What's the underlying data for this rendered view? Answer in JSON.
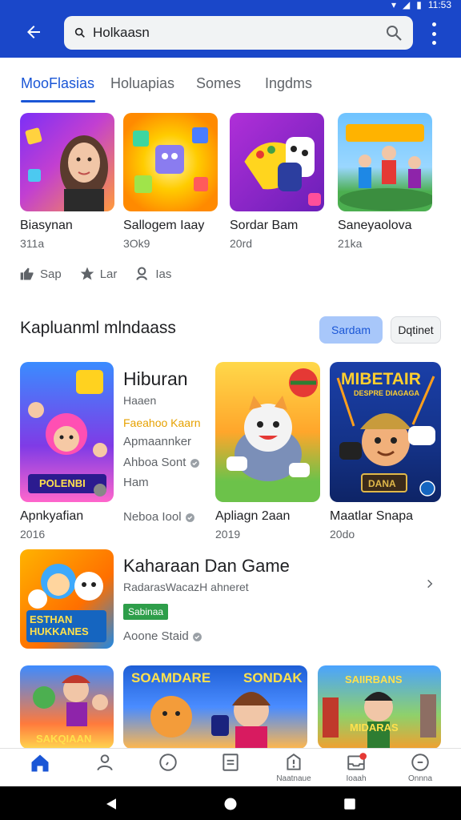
{
  "header": {
    "search_query": "Holkaasn",
    "back_icon": "arrow-back-icon",
    "search_icon": "search-icon",
    "menu_icon": "more-vert-icon",
    "brand_color": "#1a47c9"
  },
  "tabs": [
    {
      "label": "MooFlasias",
      "active": true
    },
    {
      "label": "Holuapias"
    },
    {
      "label": "Somes"
    },
    {
      "label": "Ingdms"
    }
  ],
  "featured": [
    {
      "title": "Biasynan",
      "sub": "311a"
    },
    {
      "title": "Sallogem Iaay",
      "sub": "3Ok9"
    },
    {
      "title": "Sordar Bam",
      "sub": "20rd"
    },
    {
      "title": "Saneyaolova",
      "sub": "21ka"
    }
  ],
  "meta": [
    {
      "icon": "thumb-up-icon",
      "label": "Sap"
    },
    {
      "icon": "star-icon",
      "label": "Lar"
    },
    {
      "icon": "person-icon",
      "label": "Ias"
    }
  ],
  "section": {
    "title": "Kapluanml mlndaass",
    "primary_button": "Sardam",
    "secondary_button": "Dqtinet"
  },
  "hiburan": {
    "title": "Hiburan",
    "line1": "Haaen",
    "line2": "Faeahoo Kaarn",
    "line3": "Apmaannker",
    "line4": "Ahboa Sont",
    "line5": "Ham"
  },
  "mid_tiles": [
    {
      "caption": "Apnkyafian",
      "sub": "2016"
    },
    {
      "caption": "Neboa Iool",
      "sub": ""
    },
    {
      "caption": "Apliagn 2aan",
      "sub": "2019"
    },
    {
      "caption": "Maatlar Snapa",
      "sub": "20do"
    }
  ],
  "tile_art_text": {
    "poster1": "POLENBI",
    "poster3_top": "MIBETAIR",
    "poster3_sub": "DESPRE DIAGAGA",
    "poster3_box": "DANA"
  },
  "kaharaan": {
    "title": "Kaharaan Dan Game",
    "subtitle": "RadarasWacazH ahneret",
    "badge": "Sabinaa",
    "meta": "Aoone Staid",
    "art_text": "ESTHAN HUKKANES"
  },
  "promos": [
    {
      "text": "SAKQIAAN"
    },
    {
      "text": "SOAMDARE",
      "text2": "SONDAK"
    },
    {
      "text": "SAIIRBANS",
      "text2": "MIDARAS"
    }
  ],
  "bottom_nav": [
    {
      "icon": "home-icon",
      "label": "",
      "active": true
    },
    {
      "icon": "person-outline-icon",
      "label": ""
    },
    {
      "icon": "clock-icon",
      "label": ""
    },
    {
      "icon": "document-icon",
      "label": ""
    },
    {
      "icon": "alert-icon",
      "label": "Naatnaue"
    },
    {
      "icon": "inbox-icon",
      "label": "Ioaah"
    },
    {
      "icon": "compass-icon",
      "label": "Onnna"
    }
  ],
  "status": {
    "time": "11:53"
  }
}
